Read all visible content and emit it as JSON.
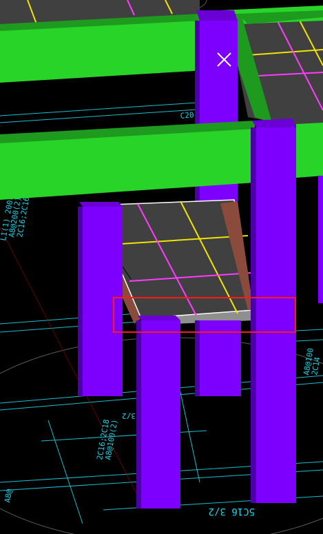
{
  "viewport": {
    "background": "#000000",
    "colors": {
      "beam_green": "#27d427",
      "beam_green_dark": "#1e9a1e",
      "column_purple": "#7d00ff",
      "column_purple_dark": "#4b00a8",
      "slab_gray": "#404040",
      "slab_edge": "#8a4a3c",
      "grid_yellow": "#f2e300",
      "grid_magenta": "#ff3cff",
      "cad_cyan": "#1ed4e6",
      "selection_red": "#ff1a1a",
      "cursor_white": "#ffffff"
    },
    "cursor": {
      "icon": "crosshair-x-icon"
    },
    "selection_box": {
      "label": "selection-rectangle"
    },
    "labels": {
      "bottom_rebar": "5C16 3/2",
      "mid_rebar": "5C16 3/2",
      "left_beam": "L1(1) 200×400",
      "left_beam_2": "A8@200(2)",
      "left_beam_3": "2C16;2C16",
      "slab_note": "C20",
      "right_note_1": "A8@100",
      "right_note_2": "2C14",
      "center_note_1": "2C16;2C18",
      "center_note_2": "A8@100(2)",
      "bottom_left": "A8@"
    }
  }
}
